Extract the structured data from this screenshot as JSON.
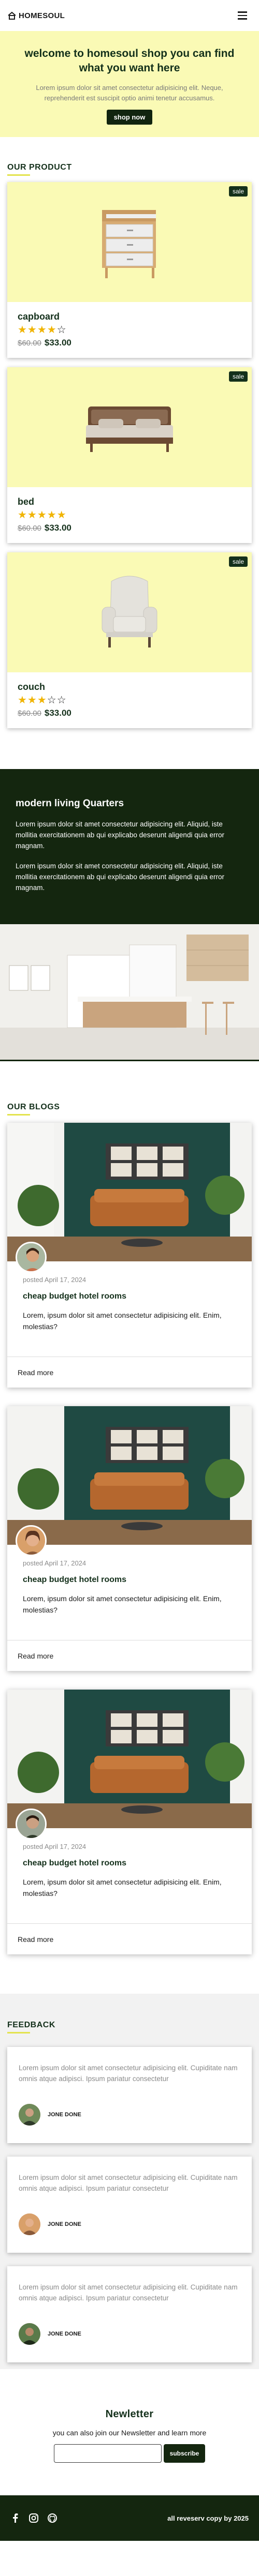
{
  "header": {
    "brand": "HOMESOUL",
    "menu_icon": "hamburger-menu-icon"
  },
  "hero": {
    "title": "welcome to homesoul shop you can find what you want here",
    "text": "Lorem ipsum dolor sit amet consectetur adipisicing elit. Neque, reprehenderit est suscipit optio animi tenetur accusamus.",
    "button": "shop now"
  },
  "products": {
    "title": "OUR PRODUCT",
    "items": [
      {
        "name": "capboard",
        "sale": "sale",
        "old_price": "$60.00",
        "new_price": "$33.00",
        "rating": 4,
        "stars": "★★★★",
        "stars_off": "☆"
      },
      {
        "name": "bed",
        "sale": "sale",
        "old_price": "$60.00",
        "new_price": "$33.00",
        "rating": 5,
        "stars": "★★★★★",
        "stars_off": ""
      },
      {
        "name": "couch",
        "sale": "sale",
        "old_price": "$60.00",
        "new_price": "$33.00",
        "rating": 3,
        "stars": "★★★",
        "stars_off": "☆☆"
      }
    ]
  },
  "living": {
    "title": "modern living Quarters",
    "p1": "Lorem ipsum dolor sit amet consectetur adipisicing elit. Aliquid, iste mollitia exercitationem ab qui explicabo deserunt aligendi quia error magnam.",
    "p2": "Lorem ipsum dolor sit amet consectetur adipisicing elit. Aliquid, iste mollitia exercitationem ab qui explicabo deserunt aligendi quia error magnam."
  },
  "blogs": {
    "title": "OUR BLOGS",
    "items": [
      {
        "posted": "posted April 17, 2024",
        "title": "cheap budget hotel rooms",
        "desc": "Lorem, ipsum dolor sit amet consectetur adipisicing elit. Enim, molestias?",
        "read_more": "Read more"
      },
      {
        "posted": "posted April 17, 2024",
        "title": "cheap budget hotel rooms",
        "desc": "Lorem, ipsum dolor sit amet consectetur adipisicing elit. Enim, molestias?",
        "read_more": "Read more"
      },
      {
        "posted": "posted April 17, 2024",
        "title": "cheap budget hotel rooms",
        "desc": "Lorem, ipsum dolor sit amet consectetur adipisicing elit. Enim, molestias?",
        "read_more": "Read more"
      }
    ]
  },
  "feedback": {
    "title": "FEEDBACK",
    "items": [
      {
        "text": "Lorem ipsum dolor sit amet consectetur adipisicing elit. Cupiditate nam omnis atque adipisci. Ipsum pariatur consectetur",
        "name": "JONE DONE"
      },
      {
        "text": "Lorem ipsum dolor sit amet consectetur adipisicing elit. Cupiditate nam omnis atque adipisci. Ipsum pariatur consectetur",
        "name": "JONE DONE"
      },
      {
        "text": "Lorem ipsum dolor sit amet consectetur adipisicing elit. Cupiditate nam omnis atque adipisci. Ipsum pariatur consectetur",
        "name": "JONE DONE"
      }
    ]
  },
  "newsletter": {
    "title": "Newletter",
    "text": "you can also join our Newsletter and learn more",
    "input_placeholder": "",
    "button": "subscribe"
  },
  "footer": {
    "copyright": "all reveserv copy by 2025",
    "socials": [
      "facebook-icon",
      "instagram-icon",
      "github-icon"
    ]
  },
  "colors": {
    "accent": "#fafab5",
    "dark": "#14260f",
    "star": "#f0b400",
    "underline": "#e3e34e"
  }
}
